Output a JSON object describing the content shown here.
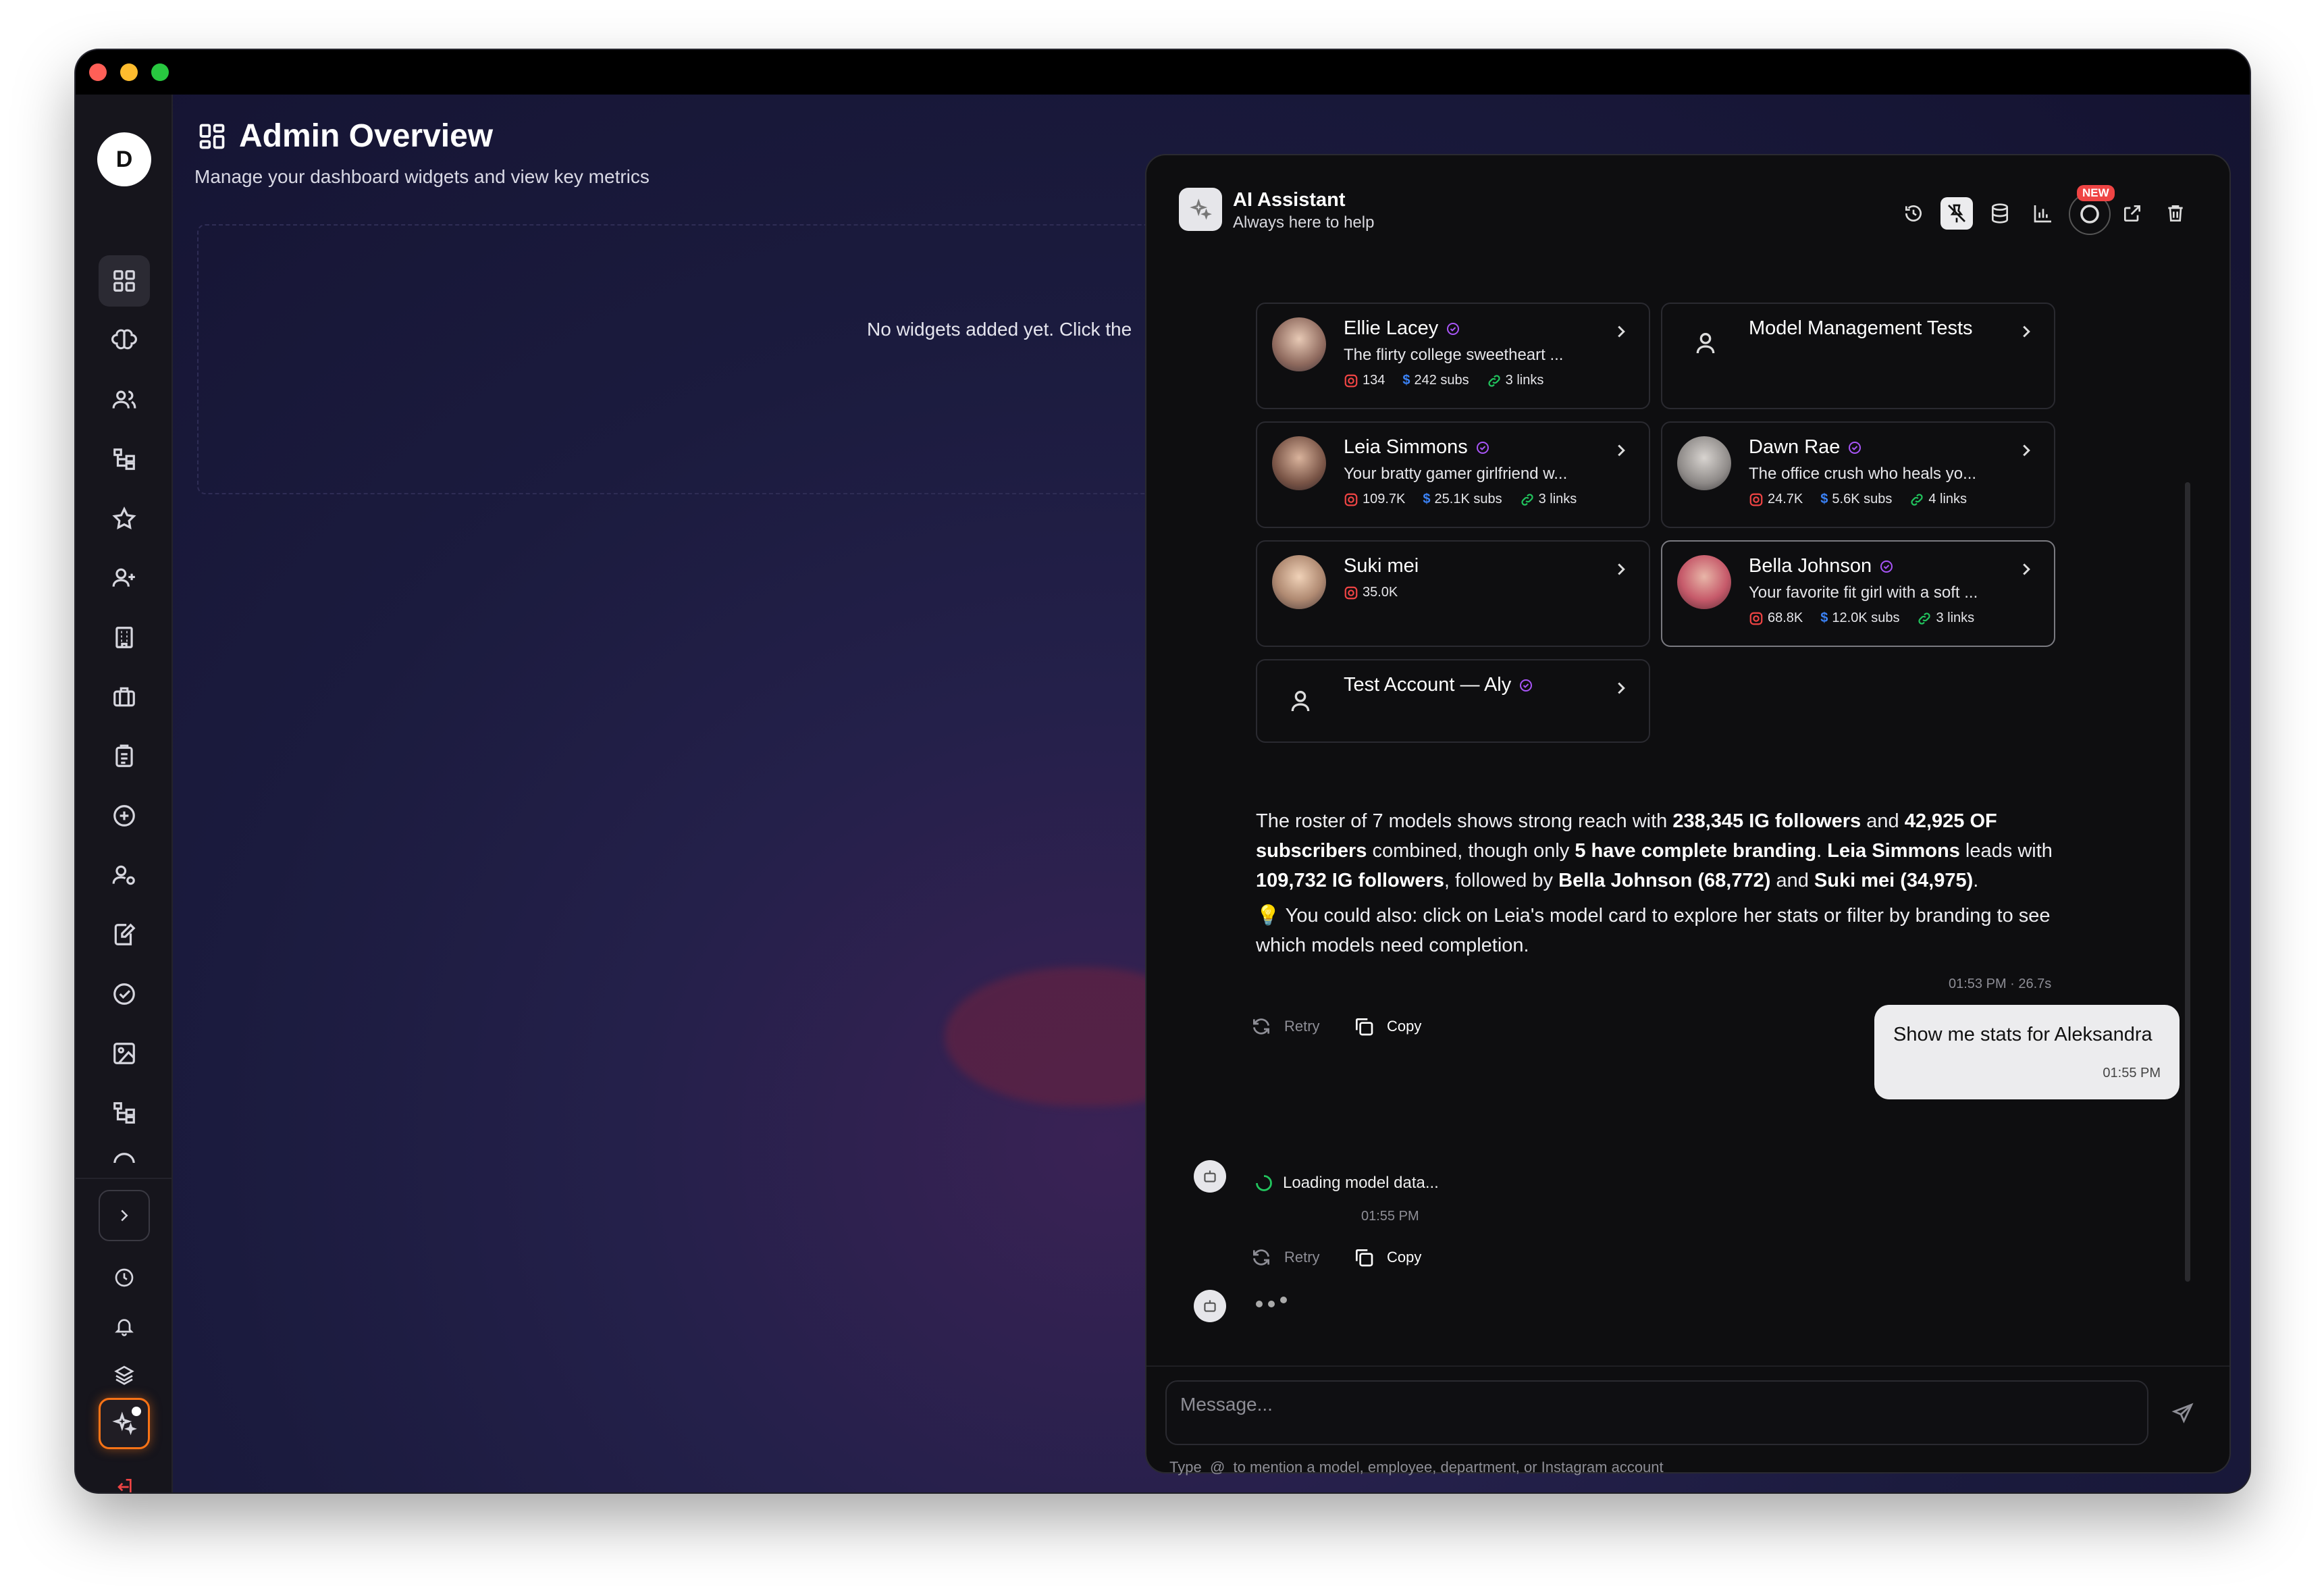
{
  "sidebar": {
    "avatar_initial": "D"
  },
  "header": {
    "title": "Admin Overview",
    "subtitle": "Manage your dashboard widgets and view key metrics",
    "empty_text": "No widgets added yet. Click the"
  },
  "assistant": {
    "title": "AI Assistant",
    "subtitle": "Always here to help",
    "new_badge": "NEW",
    "cards": [
      {
        "name": "Ellie Lacey",
        "desc": "The flirty college sweetheart ...",
        "ig": "134",
        "subs": "242 subs",
        "links": "3 links"
      },
      {
        "name": "Model Management Tests"
      },
      {
        "name": "Leia Simmons",
        "desc": "Your bratty gamer girlfriend w...",
        "ig": "109.7K",
        "subs": "25.1K subs",
        "links": "3 links"
      },
      {
        "name": "Dawn Rae",
        "desc": "The office crush who heals yo...",
        "ig": "24.7K",
        "subs": "5.6K subs",
        "links": "4 links"
      },
      {
        "name": "Suki mei",
        "ig": "35.0K"
      },
      {
        "name": "Bella Johnson",
        "desc": "Your favorite fit girl with a soft ...",
        "ig": "68.8K",
        "subs": "12.0K subs",
        "links": "3 links"
      },
      {
        "name": "Test Account — Aly"
      }
    ],
    "message": {
      "p1_a": "The roster of 7 models shows strong reach with ",
      "p1_b": "238,345 IG followers",
      "p1_c": " and ",
      "p1_d": "42,925 OF subscribers",
      "p1_e": " combined, though only ",
      "p1_f": "5 have complete branding",
      "p1_g": ". ",
      "p1_h": "Leia Simmons",
      "p1_i": " leads with ",
      "p1_j": "109,732 IG followers",
      "p1_k": ", followed by ",
      "p1_l": "Bella Johnson (68,772)",
      "p1_m": " and ",
      "p1_n": "Suki mei (34,975)",
      "p1_o": ".",
      "p2": "You could also: click on Leia's model card to explore her stats or filter by branding to see which models need completion.",
      "meta": "01:53 PM · 26.7s"
    },
    "actions": {
      "retry": "Retry",
      "copy": "Copy"
    },
    "user_message": {
      "text": "Show me stats for Aleksandra",
      "time": "01:55 PM"
    },
    "loading": {
      "text": "Loading model data...",
      "time": "01:55 PM"
    },
    "input_placeholder": "Message...",
    "hint_type": "Type",
    "hint_at": "@",
    "hint_rest": "to mention a model, employee, department, or Instagram account"
  },
  "colors": {
    "accent_purple": "#a855f7",
    "instagram_red": "#ef4444",
    "subs_blue": "#3b82f6",
    "links_green": "#22c55e",
    "new_badge": "#ef4444",
    "sidebar_ai_highlight": "#f97316"
  }
}
